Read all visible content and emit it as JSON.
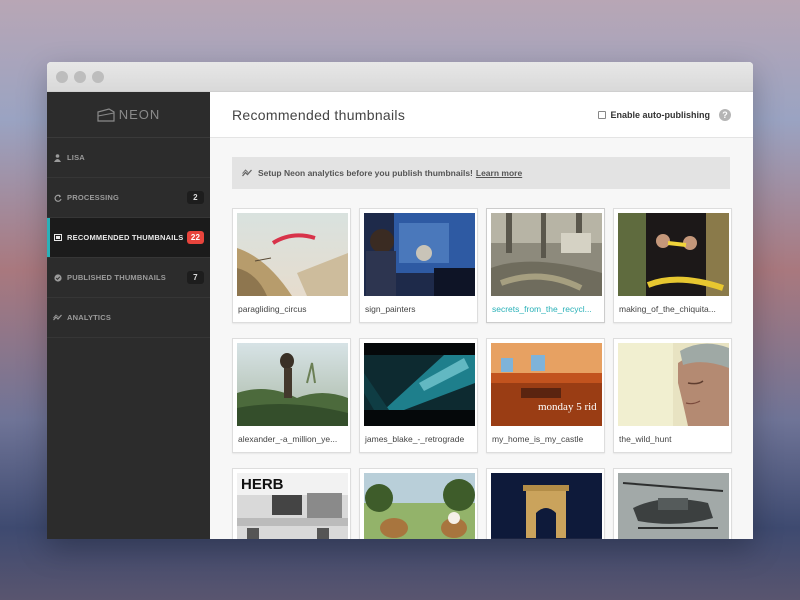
{
  "window": {
    "controls": [
      "close",
      "minimize",
      "zoom"
    ]
  },
  "brand": {
    "name": "NEON",
    "logo_icon": "neon-logo-icon"
  },
  "sidebar": {
    "items": [
      {
        "label": "LISA",
        "icon": "user-icon",
        "count": null,
        "active": false
      },
      {
        "label": "PROCESSING",
        "icon": "refresh-icon",
        "count": "2",
        "active": false
      },
      {
        "label": "RECOMMENDED THUMBNAILS",
        "icon": "image-icon",
        "count": "22",
        "active": true
      },
      {
        "label": "PUBLISHED THUMBNAILS",
        "icon": "check-circle-icon",
        "count": "7",
        "active": false
      },
      {
        "label": "ANALYTICS",
        "icon": "analytics-icon",
        "count": null,
        "active": false
      }
    ]
  },
  "header": {
    "title": "Recommended thumbnails",
    "auto_publish_label": "Enable auto-publishing",
    "auto_publish_checked": false,
    "help": "?"
  },
  "notice": {
    "text": "Setup Neon analytics before you publish thumbnails!",
    "link": "Learn more"
  },
  "thumbnails": [
    {
      "label": "paragliding_circus"
    },
    {
      "label": "sign_painters"
    },
    {
      "label": "secrets_from_the_recycl..."
    },
    {
      "label": "making_of_the_chiquita..."
    },
    {
      "label": "alexander_-a_million_ye..."
    },
    {
      "label": "james_blake_-_retrograde"
    },
    {
      "label": "my_home_is_my_castle",
      "overlay": "monday 5 rid"
    },
    {
      "label": "the_wild_hunt"
    },
    {
      "label": "",
      "overlay": "HERB"
    },
    {
      "label": ""
    },
    {
      "label": ""
    },
    {
      "label": ""
    }
  ],
  "colors": {
    "accent": "#2ab1b8",
    "alert": "#e8443c",
    "sidebar": "#2c2c2c"
  }
}
